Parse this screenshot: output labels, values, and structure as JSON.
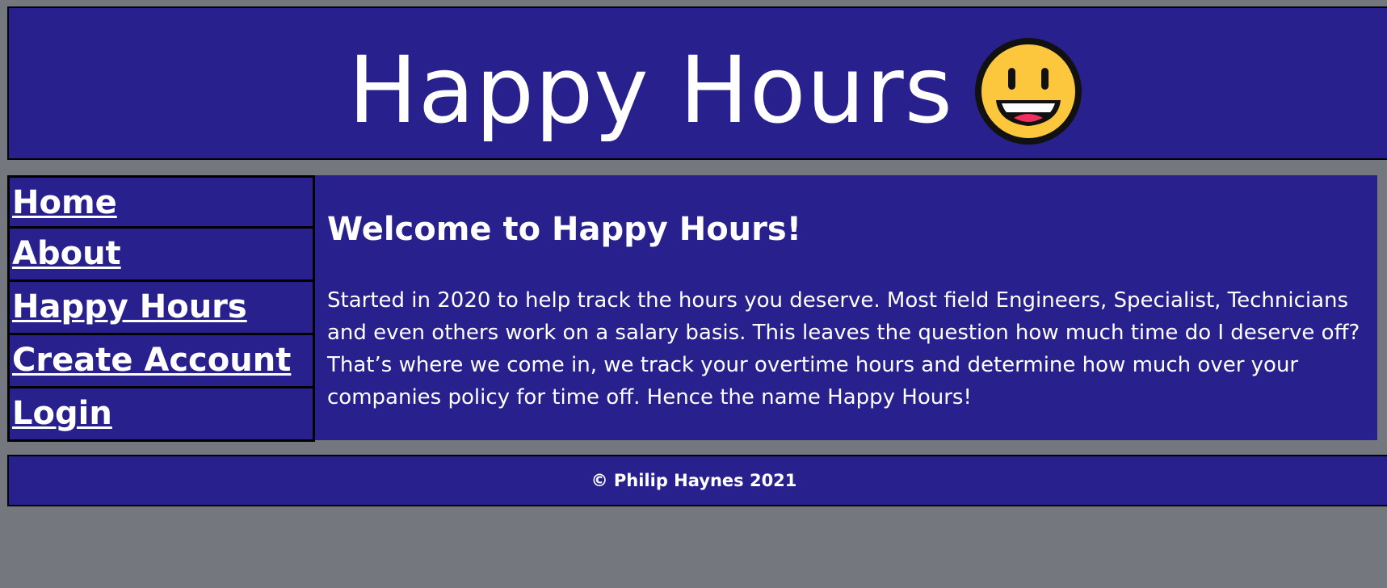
{
  "header": {
    "title": "Happy Hours",
    "emoji_icon": "grinning-face-icon"
  },
  "nav": {
    "items": [
      {
        "label": "Home"
      },
      {
        "label": "About"
      },
      {
        "label": "Happy Hours"
      },
      {
        "label": "Create Account"
      },
      {
        "label": "Login"
      }
    ]
  },
  "main": {
    "heading": "Welcome to Happy Hours!",
    "paragraph": "Started in 2020 to help track the hours you deserve. Most field Engineers, Specialist, Technicians and even others work on a salary basis. This leaves the question how much time do I deserve off? That’s where we come in, we track your overtime hours and determine how much over your companies policy for time off. Hence the name Happy Hours!"
  },
  "footer": {
    "copyright": "© Philip Haynes 2021"
  },
  "colors": {
    "page_background": "#75777e",
    "panel_background": "#28208d",
    "text": "#ffffff",
    "border": "#000000",
    "emoji_yellow": "#fcc73d"
  }
}
